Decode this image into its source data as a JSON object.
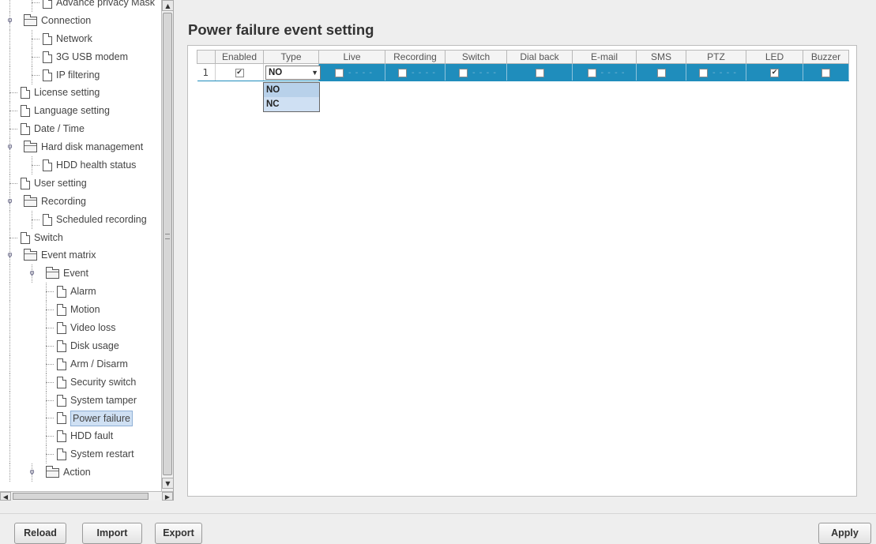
{
  "tree": {
    "items": [
      {
        "label": "Advance privacy Mask",
        "type": "doc",
        "level": 1
      },
      {
        "label": "Connection",
        "type": "folder",
        "level": 0,
        "expanded": true
      },
      {
        "label": "Network",
        "type": "doc",
        "level": 1
      },
      {
        "label": "3G USB modem",
        "type": "doc",
        "level": 1
      },
      {
        "label": "IP filtering",
        "type": "doc",
        "level": 1
      },
      {
        "label": "License setting",
        "type": "doc",
        "level": 0
      },
      {
        "label": "Language setting",
        "type": "doc",
        "level": 0
      },
      {
        "label": "Date / Time",
        "type": "doc",
        "level": 0
      },
      {
        "label": "Hard disk management",
        "type": "folder",
        "level": 0,
        "expanded": true
      },
      {
        "label": "HDD health status",
        "type": "doc",
        "level": 1
      },
      {
        "label": "User setting",
        "type": "doc",
        "level": 0
      },
      {
        "label": "Recording",
        "type": "folder",
        "level": 0,
        "expanded": true
      },
      {
        "label": "Scheduled recording",
        "type": "doc",
        "level": 1
      },
      {
        "label": "Switch",
        "type": "doc",
        "level": 0
      },
      {
        "label": "Event matrix",
        "type": "folder",
        "level": 0,
        "expanded": true
      },
      {
        "label": "Event",
        "type": "folder",
        "level": 1,
        "expanded": true
      },
      {
        "label": "Alarm",
        "type": "doc",
        "level": 2
      },
      {
        "label": "Motion",
        "type": "doc",
        "level": 2
      },
      {
        "label": "Video loss",
        "type": "doc",
        "level": 2
      },
      {
        "label": "Disk usage",
        "type": "doc",
        "level": 2
      },
      {
        "label": "Arm / Disarm",
        "type": "doc",
        "level": 2
      },
      {
        "label": "Security switch",
        "type": "doc",
        "level": 2
      },
      {
        "label": "System tamper",
        "type": "doc",
        "level": 2
      },
      {
        "label": "Power failure",
        "type": "doc",
        "level": 2,
        "selected": true
      },
      {
        "label": "HDD fault",
        "type": "doc",
        "level": 2
      },
      {
        "label": "System restart",
        "type": "doc",
        "level": 2
      },
      {
        "label": "Action",
        "type": "folder",
        "level": 1,
        "expanded": true
      }
    ]
  },
  "main": {
    "title": "Power failure event setting",
    "columns": [
      "Enabled",
      "Type",
      "Live",
      "Recording",
      "Switch",
      "Dial back",
      "E-mail",
      "SMS",
      "PTZ",
      "LED",
      "Buzzer"
    ],
    "rows": [
      {
        "index": "1",
        "enabled": true,
        "type": "NO",
        "live": false,
        "recording": false,
        "switch": false,
        "dial_back": false,
        "email": false,
        "sms": false,
        "ptz": false,
        "led": true,
        "buzzer": false
      }
    ],
    "type_options": [
      "NO",
      "NC"
    ]
  },
  "buttons": {
    "reload": "Reload",
    "import": "Import",
    "export": "Export",
    "apply": "Apply"
  },
  "colors": {
    "selected_row": "#1f8dbc",
    "tree_selection": "#cfe0f3"
  }
}
